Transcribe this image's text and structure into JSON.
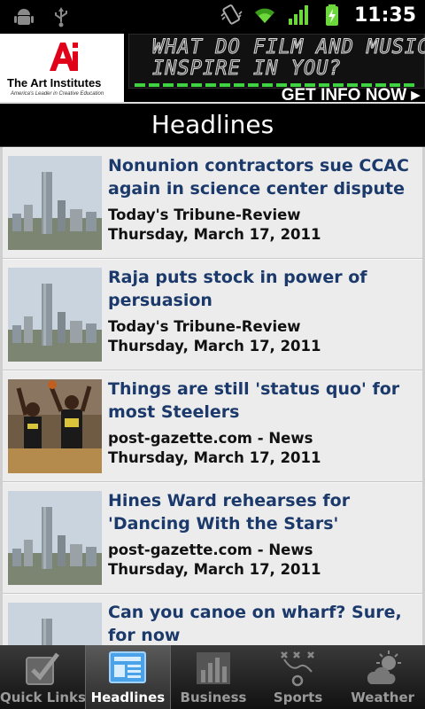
{
  "status_bar": {
    "time": "11:35",
    "icons": [
      "android-debug-icon",
      "usb-icon",
      "vibrate-icon",
      "wifi-icon",
      "signal-icon",
      "battery-charging-icon"
    ]
  },
  "ad": {
    "logo_mark": "Ai",
    "brand": "The Art Institutes",
    "tagline": "America's Leader in Creative Education",
    "line1": "WHAT DO FILM AND MUSIC",
    "line2": "INSPIRE IN YOU?",
    "cta": "GET INFO NOW",
    "accent": "#e0001a",
    "dot_color": "#3fd13f"
  },
  "page": {
    "title": "Headlines"
  },
  "articles": [
    {
      "headline": "Nonunion contractors sue CCAC again in science center dispute",
      "source": "Today's Tribune-Review",
      "date": "Thursday, March 17, 2011",
      "thumbnail": "city-skyline"
    },
    {
      "headline": "Raja puts stock in power of persuasion",
      "source": "Today's Tribune-Review",
      "date": "Thursday, March 17, 2011",
      "thumbnail": "city-skyline"
    },
    {
      "headline": "Things are still 'status quo' for most Steelers",
      "source": "post-gazette.com - News",
      "date": "Thursday, March 17, 2011",
      "thumbnail": "basketball-players"
    },
    {
      "headline": "Hines Ward rehearses for 'Dancing With the Stars'",
      "source": "post-gazette.com - News",
      "date": "Thursday, March 17, 2011",
      "thumbnail": "city-skyline"
    },
    {
      "headline": "Can you canoe on wharf? Sure, for now",
      "source": "",
      "date": "",
      "thumbnail": "city-skyline"
    }
  ],
  "tabs": [
    {
      "label": "Quick Links",
      "icon": "checkbox-icon",
      "active": false
    },
    {
      "label": "Headlines",
      "icon": "newspaper-icon",
      "active": true
    },
    {
      "label": "Business",
      "icon": "bar-chart-icon",
      "active": false
    },
    {
      "label": "Sports",
      "icon": "play-diagram-icon",
      "active": false
    },
    {
      "label": "Weather",
      "icon": "sun-cloud-icon",
      "active": false
    }
  ]
}
